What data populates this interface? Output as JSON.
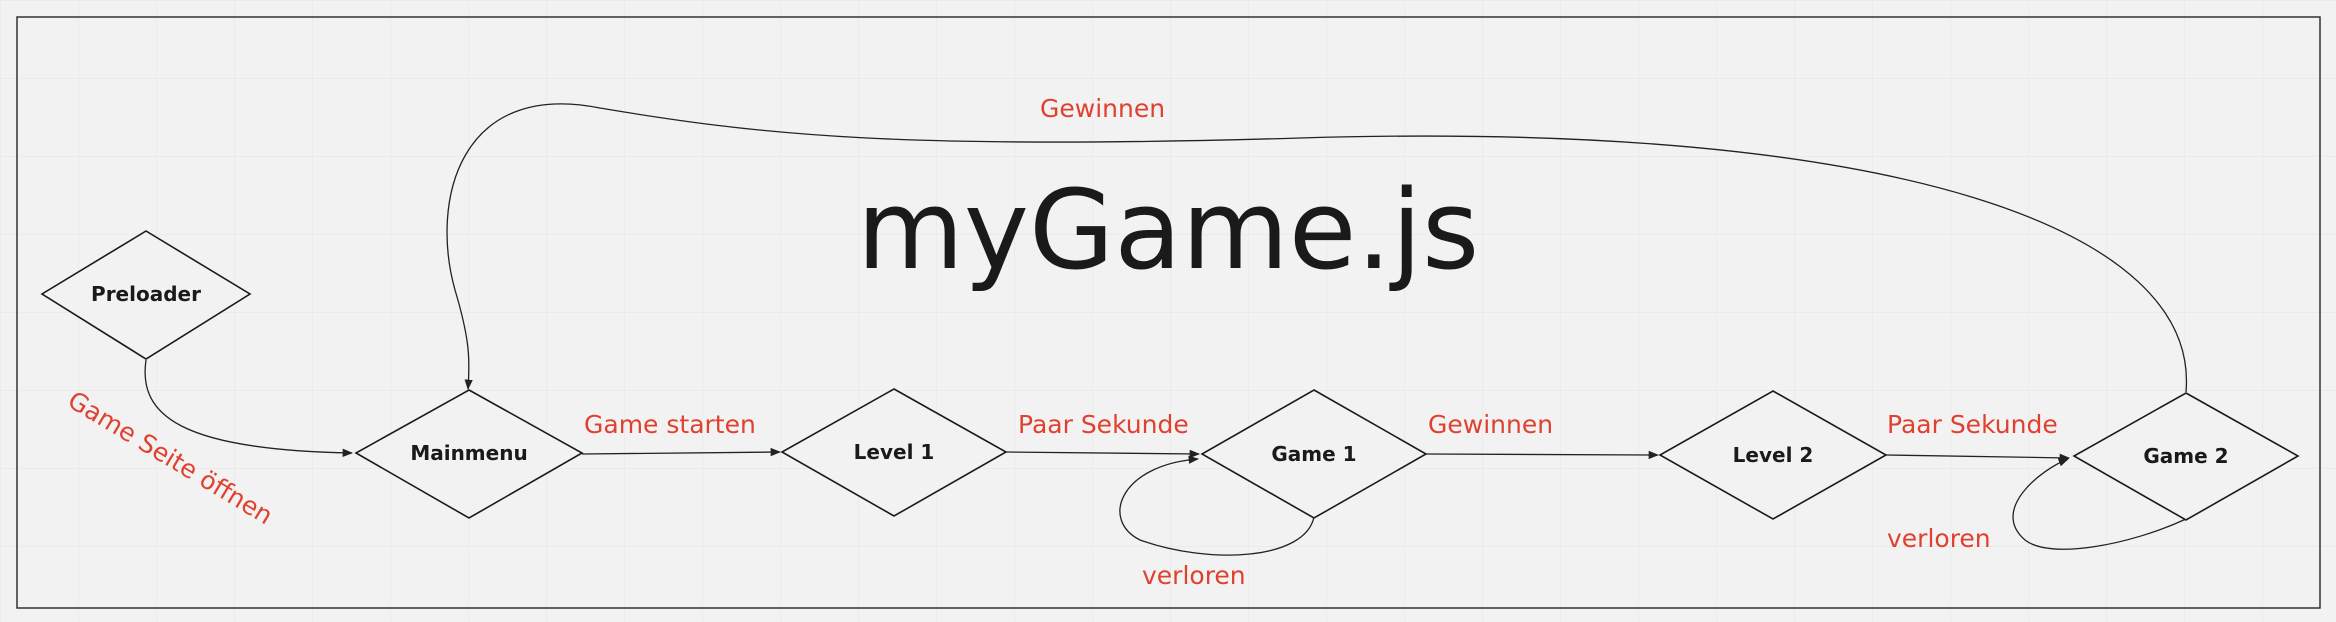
{
  "title": "myGame.js",
  "colors": {
    "canvas": "#f2f2f2",
    "grid": "#e4e4e4",
    "frame": "#333333",
    "node_text": "#1a1a1a",
    "edge_label": "#e0412f"
  },
  "nodes": {
    "preloader": "Preloader",
    "mainmenu": "Mainmenu",
    "level1": "Level 1",
    "game1": "Game 1",
    "level2": "Level 2",
    "game2": "Game 2"
  },
  "edges": {
    "open_page": "Game Seite öffnen",
    "start_game": "Game starten",
    "wait_1": "Paar Sekunde",
    "win_1": "Gewinnen",
    "wait_2": "Paar Sekunde",
    "lose_1": "verloren",
    "lose_2": "verloren",
    "win_2": "Gewinnen"
  }
}
